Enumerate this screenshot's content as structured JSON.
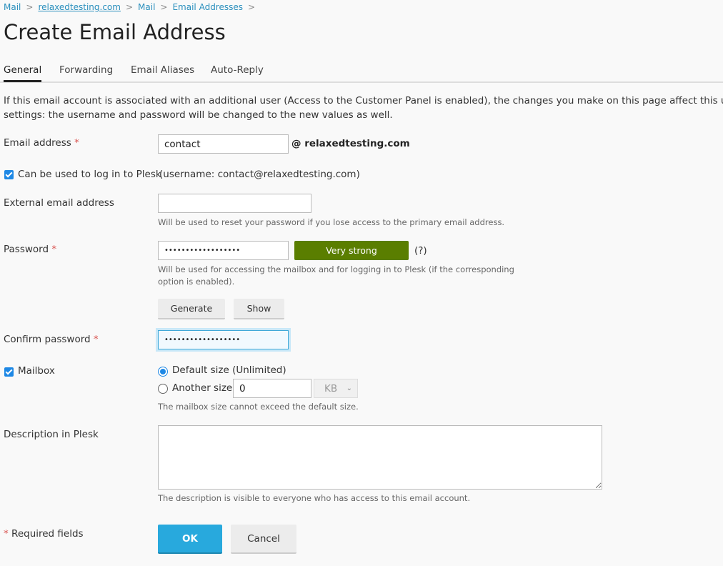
{
  "breadcrumb": [
    {
      "label": "Mail"
    },
    {
      "label": "relaxedtesting.com"
    },
    {
      "label": "Mail"
    },
    {
      "label": "Email Addresses"
    }
  ],
  "page_title": "Create Email Address",
  "tabs": [
    {
      "label": "General",
      "active": true
    },
    {
      "label": "Forwarding"
    },
    {
      "label": "Email Aliases"
    },
    {
      "label": "Auto-Reply"
    }
  ],
  "info_text": "If this email account is associated with an additional user (Access to the Customer Panel is enabled), the changes you make on this page affect this user's settings: the username and password will be changed to the new values as well.",
  "form": {
    "email": {
      "label": "Email address",
      "required_mark": "*",
      "value": "contact",
      "domain_suffix": "@ relaxedtesting.com"
    },
    "login": {
      "label": "Can be used to log in to Plesk",
      "checked": true,
      "username_note": "(username: contact@relaxedtesting.com)"
    },
    "external_email": {
      "label": "External email address",
      "value": "",
      "hint": "Will be used to reset your password if you lose access to the primary email address."
    },
    "password": {
      "label": "Password",
      "required_mark": "*",
      "value": "••••••••••••••••••",
      "strength": "Very strong",
      "strength_color": "#5a7e00",
      "help": "(?)",
      "hint": "Will be used for accessing the mailbox and for logging in to Plesk (if the corresponding option is enabled).",
      "generate_label": "Generate",
      "show_label": "Show"
    },
    "confirm_password": {
      "label": "Confirm password",
      "required_mark": "*",
      "value": "••••••••••••••••••"
    },
    "mailbox": {
      "label": "Mailbox",
      "checked": true,
      "default_size_label": "Default size (Unlimited)",
      "another_size_label": "Another size",
      "another_size_value": "0",
      "unit": "KB",
      "hint": "The mailbox size cannot exceed the default size."
    },
    "description": {
      "label": "Description in Plesk",
      "value": "",
      "hint": "The description is visible to everyone who has access to this email account."
    },
    "required_note_mark": "*",
    "required_note": " Required fields",
    "ok_label": "OK",
    "cancel_label": "Cancel"
  },
  "colors": {
    "accent": "#28a9dd",
    "link": "#2a8fbd",
    "required": "#d9534f"
  }
}
